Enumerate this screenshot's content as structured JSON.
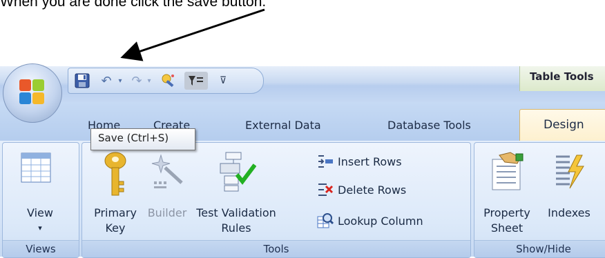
{
  "instruction": "When you are done click the save button.",
  "titlebar": {
    "context_title": "Table Tools",
    "qat_dropdown_glyph": "⊽"
  },
  "tabs": [
    {
      "label": "Home"
    },
    {
      "label": "Create"
    },
    {
      "label": "External Data"
    },
    {
      "label": "Database Tools"
    },
    {
      "label": "Design"
    }
  ],
  "tooltip": "Save (Ctrl+S)",
  "groups": {
    "views": {
      "label": "Views",
      "view_button": {
        "label": "View",
        "caret": "▾"
      }
    },
    "tools": {
      "label": "Tools",
      "primary_key": {
        "line1": "Primary",
        "line2": "Key"
      },
      "builder": {
        "label": "Builder"
      },
      "test_validation": {
        "line1": "Test Validation",
        "line2": "Rules"
      },
      "insert_rows": "Insert Rows",
      "delete_rows": "Delete Rows",
      "lookup_column": "Lookup Column"
    },
    "show_hide": {
      "label": "Show/Hide",
      "property_sheet": {
        "line1": "Property",
        "line2": "Sheet"
      },
      "indexes": {
        "label": "Indexes"
      }
    }
  },
  "colors": {
    "ribbon_bg": "#d4e3f7",
    "design_tab": "#fdf0ce",
    "context_tab": "#dce9cb"
  }
}
